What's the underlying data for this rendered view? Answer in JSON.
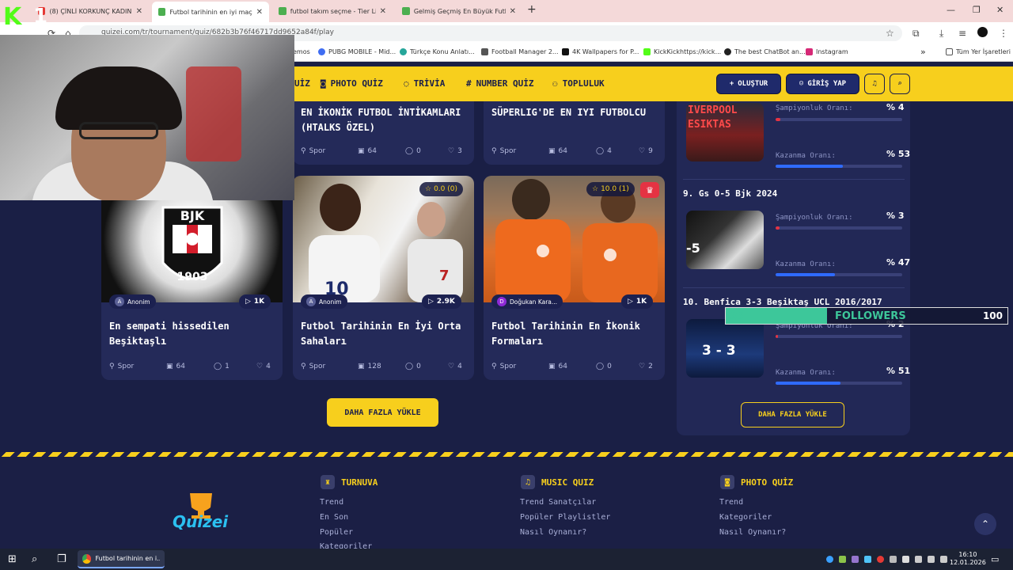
{
  "browser": {
    "tabs": [
      {
        "label": "(8) ÇİNLİ KORKUNÇ KADIN K...",
        "active": false
      },
      {
        "label": "Futbol tarihinin en iyi maçı (Sor...",
        "active": true
      },
      {
        "label": "futbol takım seçme - Tier List |...",
        "active": false
      },
      {
        "label": "Gelmiş Geçmiş En Büyük Futbo...",
        "active": false
      }
    ],
    "new_tab": "+",
    "url": "quizei.com/tr/tournament/quiz/682b3b76f46717dd9652a84f/play",
    "bookmarks": [
      "emos",
      "PUBG MOBILE - Mid...",
      "Türkçe Konu Anlatı...",
      "Football Manager 2...",
      "4K Wallpapers for P...",
      "KickKickhttps://kick...",
      "The best ChatBot an...",
      "Instagram"
    ],
    "bookmarks_more": "»",
    "all_bookmarks": "Tüm Yer İşaretleri"
  },
  "nav": {
    "items": [
      "UİZ",
      "PHOTO QUİZ",
      "TRİVİA",
      "NUMBER QUİZ",
      "TOPLULUK"
    ],
    "create": "OLUŞTUR",
    "login": "GİRİŞ YAP"
  },
  "top_cards": [
    {
      "title": "EN İKONİK FUTBOL İNTİKAMLARI (HTALKS ÖZEL)",
      "category": "Spor",
      "items": "64",
      "comments": "0",
      "likes": "3"
    },
    {
      "title": "SÜPERLIG'DE EN IYI FUTBOLCU",
      "category": "Spor",
      "items": "64",
      "comments": "4",
      "likes": "9"
    }
  ],
  "cards": [
    {
      "title": "En sempati hissedilen Beşiktaşlı",
      "author": "Anonim",
      "author_initial": "A",
      "plays": "1K",
      "category": "Spor",
      "items": "64",
      "comments": "1",
      "likes": "4",
      "rating": ""
    },
    {
      "title": "Futbol Tarihinin En İyi Orta Sahaları",
      "author": "Anonim",
      "author_initial": "A",
      "plays": "2.9K",
      "category": "Spor",
      "items": "128",
      "comments": "0",
      "likes": "4",
      "rating": "0.0 (0)"
    },
    {
      "title": "Futbol Tarihinin En İkonik Formaları",
      "author": "Doğukan Kara...",
      "author_initial": "D",
      "plays": "1K",
      "category": "Spor",
      "items": "64",
      "comments": "0",
      "likes": "2",
      "rating": "10.0 (1)"
    }
  ],
  "load_more": "DAHA FAZLA YÜKLE",
  "ranking": {
    "items": [
      {
        "title": "",
        "thumb_text_1": "IVERPOOL",
        "thumb_text_2": "ESIKTAS",
        "champ_label": "Şampiyonluk Oranı:",
        "champ_value": "% 4",
        "champ_pct": 4,
        "win_label": "Kazanma Oranı:",
        "win_value": "% 53",
        "win_pct": 53
      },
      {
        "title": "9. Gs 0-5 Bjk 2024",
        "thumb_text_1": "-5",
        "thumb_text_2": "",
        "champ_label": "Şampiyonluk Oranı:",
        "champ_value": "% 3",
        "champ_pct": 3,
        "win_label": "Kazanma Oranı:",
        "win_value": "% 47",
        "win_pct": 47
      },
      {
        "title": "10. Benfica 3-3 Beşiktaş UCL 2016/2017",
        "thumb_text_1": "3 - 3",
        "thumb_text_2": "",
        "champ_label": "Şampiyonluk Oranı:",
        "champ_value": "% 2",
        "champ_pct": 2,
        "win_label": "Kazanma Oranı:",
        "win_value": "% 51",
        "win_pct": 51
      }
    ],
    "load_more": "DAHA FAZLA YÜKLE"
  },
  "footer": {
    "columns": [
      {
        "title": "TURNUVA",
        "icon": "trophy-icon",
        "links": [
          "Trend",
          "En Son",
          "Popüler",
          "Kategoriler"
        ]
      },
      {
        "title": "MUSIC QUIZ",
        "icon": "music-icon",
        "links": [
          "Trend Sanatçılar",
          "Popüler Playlistler",
          "Nasıl Oynanır?"
        ]
      },
      {
        "title": "PHOTO QUİZ",
        "icon": "camera-icon",
        "links": [
          "Trend",
          "Kategoriler",
          "Nasıl Oynanır?"
        ]
      }
    ],
    "logo": "Quizei"
  },
  "stream_overlay": {
    "kick_badge": "1",
    "followers_current": "36",
    "followers_label": "FOLLOWERS",
    "followers_goal": "100",
    "followers_pct": 36
  },
  "taskbar": {
    "app_label": "Futbol tarihinin en i...",
    "time": "16:10",
    "date": "12.01.2026"
  },
  "colors": {
    "accent": "#f7cf1d",
    "navy": "#1a1f45",
    "red_bar": "#e53343",
    "blue_bar": "#2f6bff"
  }
}
